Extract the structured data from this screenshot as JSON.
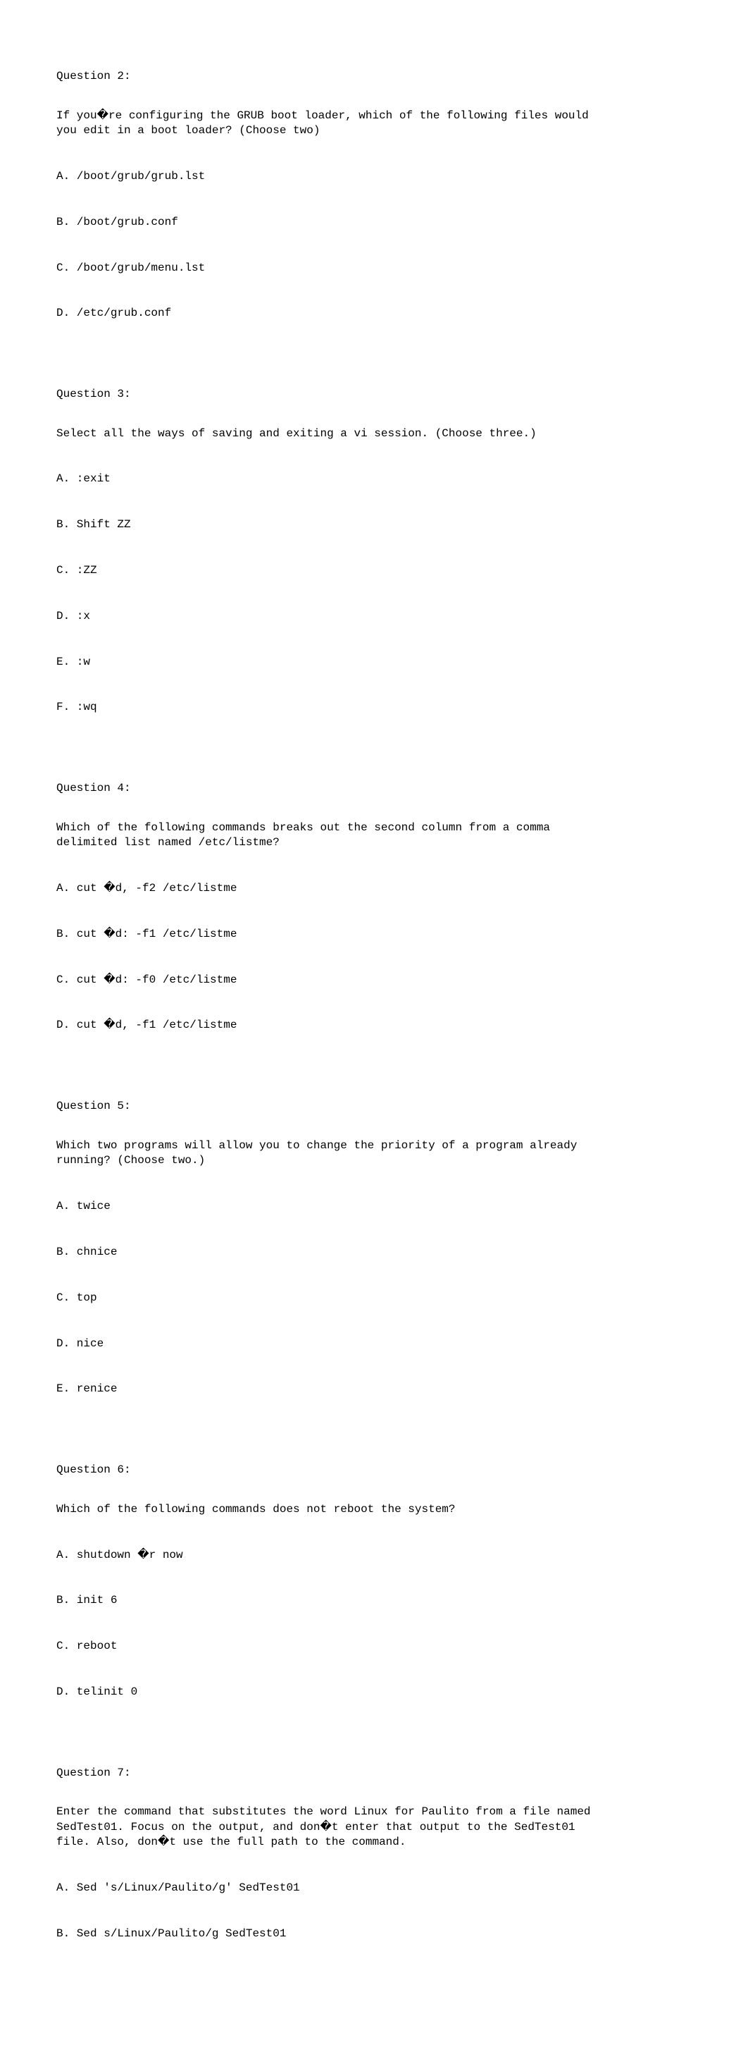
{
  "questions": [
    {
      "header": "Question 2:",
      "text": "If you�re configuring the GRUB boot loader, which of the following files would\nyou edit in a boot loader? (Choose two)",
      "options": [
        "A. /boot/grub/grub.lst",
        "B. /boot/grub.conf",
        "C. /boot/grub/menu.lst",
        "D. /etc/grub.conf"
      ]
    },
    {
      "header": "Question 3:",
      "text": "Select all the ways of saving and exiting a vi session. (Choose three.)",
      "options": [
        "A. :exit",
        "B. Shift ZZ",
        "C. :ZZ",
        "D. :x",
        "E. :w",
        "F. :wq"
      ]
    },
    {
      "header": "Question 4:",
      "text": "Which of the following commands breaks out the second column from a comma\ndelimited list named /etc/listme?",
      "options": [
        "A. cut �d, -f2 /etc/listme",
        "B. cut �d: -f1 /etc/listme",
        "C. cut �d: -f0 /etc/listme",
        "D. cut �d, -f1 /etc/listme"
      ]
    },
    {
      "header": "Question 5:",
      "text": "Which two programs will allow you to change the priority of a program already\nrunning? (Choose two.)",
      "options": [
        "A. twice",
        "B. chnice",
        "C. top",
        "D. nice",
        "E. renice"
      ]
    },
    {
      "header": "Question 6:",
      "text": "Which of the following commands does not reboot the system?",
      "options": [
        "A. shutdown �r now",
        "B. init 6",
        "C. reboot",
        "D. telinit 0"
      ]
    },
    {
      "header": "Question 7:",
      "text": "Enter the command that substitutes the word Linux for Paulito from a file named\nSedTest01. Focus on the output, and don�t enter that output to the SedTest01\nfile. Also, don�t use the full path to the command.",
      "options": [
        "A. Sed 's/Linux/Paulito/g' SedTest01",
        "B. Sed s/Linux/Paulito/g SedTest01"
      ]
    }
  ]
}
